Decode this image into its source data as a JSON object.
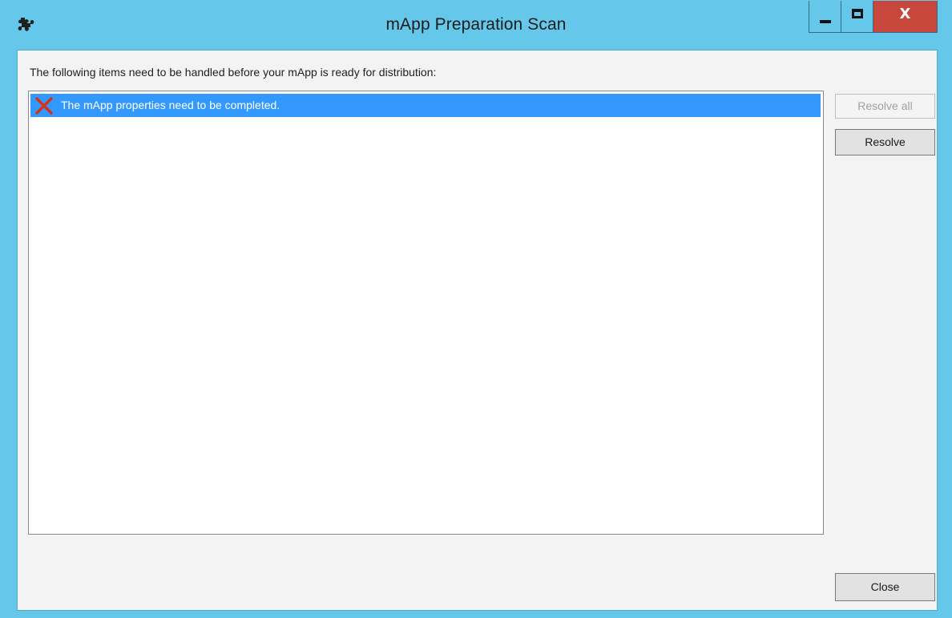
{
  "window": {
    "title": "mApp Preparation Scan",
    "app_icon": "puzzle-icon",
    "controls": {
      "minimize_icon": "minimize-icon",
      "maximize_icon": "maximize-icon",
      "close_label": "X"
    },
    "colors": {
      "titlebar": "#65c8eb",
      "close_button": "#c8473c",
      "selection": "#3399ff",
      "error_x": "#d0361f"
    }
  },
  "main": {
    "instructions": "The following items need to be handled before your mApp is ready for distribution:",
    "items": [
      {
        "icon": "error-x-icon",
        "text": "The mApp properties need to be completed.",
        "selected": true
      }
    ]
  },
  "buttons": {
    "resolve_all": "Resolve all",
    "resolve_all_enabled": false,
    "resolve": "Resolve",
    "close": "Close"
  }
}
